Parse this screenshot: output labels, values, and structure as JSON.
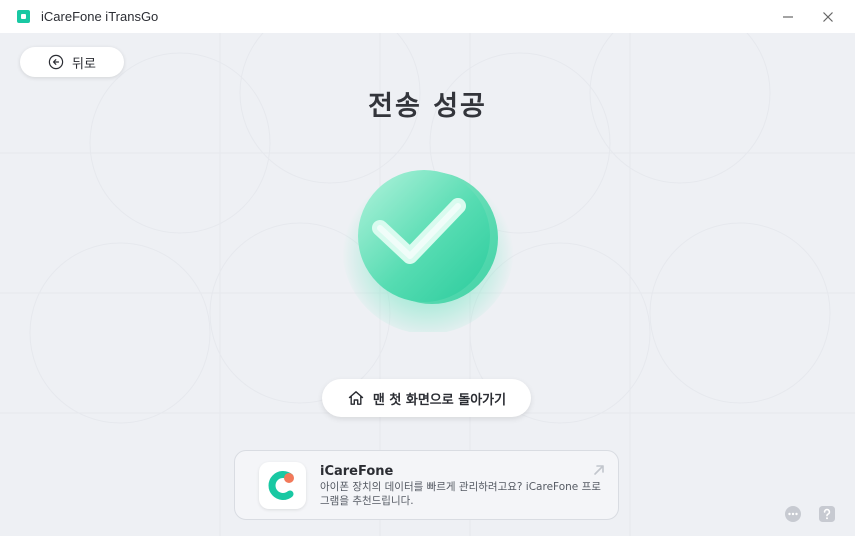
{
  "window": {
    "title": "iCareFone iTransGo",
    "minimize_icon": "minimize-icon",
    "close_icon": "close-icon"
  },
  "back_button": {
    "label": "뒤로",
    "icon": "arrow-left-circle-icon"
  },
  "main": {
    "title": "전송 성공",
    "status_icon": "checkmark-icon"
  },
  "home_button": {
    "label": "맨 첫 화면으로 돌아가기",
    "icon": "home-icon"
  },
  "promo": {
    "name": "iCareFone",
    "description": "아이폰 장치의 데이터를 빠르게 관리하려고요? iCareFone 프로그램을 추천드립니다.",
    "icon": "icarefone-logo",
    "arrow_icon": "arrow-up-right-icon"
  },
  "footer": {
    "chat_icon": "chat-icon",
    "help_icon": "help-icon"
  },
  "colors": {
    "accent": "#19c8a3",
    "background": "#eef0f4",
    "orb_light": "#a8f0d8",
    "orb_dark": "#2fd3a6"
  }
}
